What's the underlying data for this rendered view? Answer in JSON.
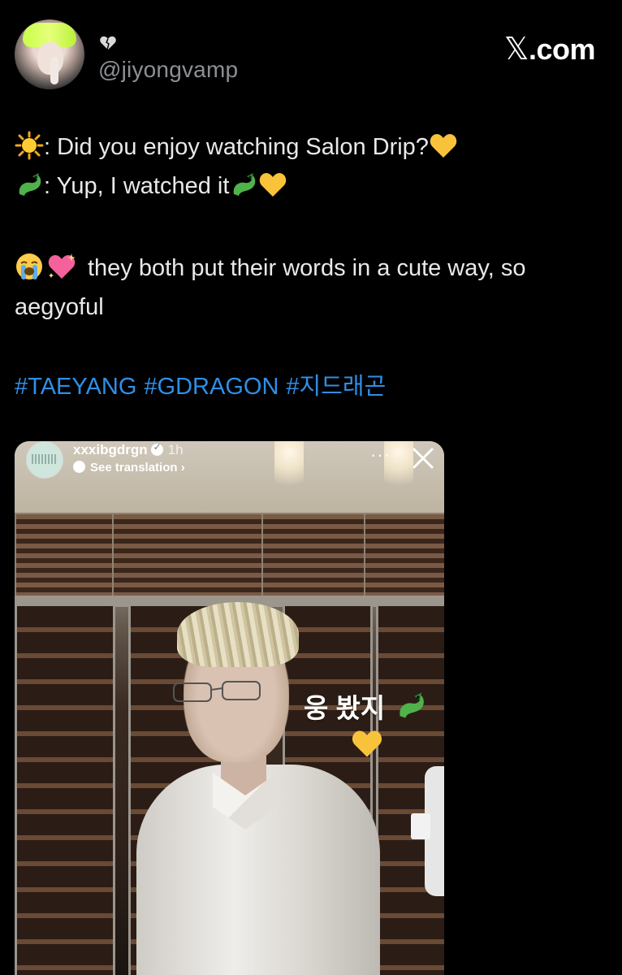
{
  "header": {
    "handle": "@jiyongvamp",
    "brand": "X.com",
    "brand_x": "𝕏",
    "brand_rest": ".com"
  },
  "tweet": {
    "line1": ": Did you enjoy watching Salon Drip?",
    "line2": ": Yup, I watched it",
    "line3": "they both put their words in a cute way, so",
    "line4": "aegyoful",
    "hashtags": [
      "#TAEYANG",
      "#GDRAGON",
      "#지드래곤"
    ]
  },
  "story": {
    "username": "xxxibgdrgn",
    "time": "1h",
    "see_translation": "See translation",
    "chevron": "›",
    "dots": "···",
    "sticker_text": "웅 봤지"
  },
  "icons": {
    "heart_icon": "broken-heart-icon",
    "sun_icon": "sun-icon",
    "dragon_icon": "dragon-icon",
    "yellow_heart_icon": "yellow-heart-icon",
    "crying_icon": "crying-face-icon",
    "sparkling_heart_icon": "sparkling-heart-icon"
  },
  "colors": {
    "background": "#000000",
    "text": "#e7e9ea",
    "handle": "#8b9096",
    "link": "#2f8fe6",
    "yellow_heart": "#f8c33a"
  }
}
